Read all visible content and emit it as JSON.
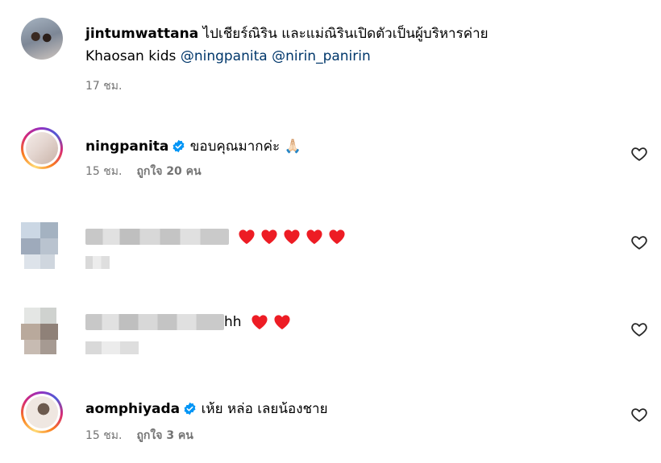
{
  "caption": {
    "username": "jintumwattana",
    "text_line1": " ไปเชียร์ณิริน และแม่ณิรินเปิดตัวเป็นผู้บริหารค่าย",
    "text_line2": "Khaosan kids ",
    "mention1": "@ningpanita",
    "mention2": "@nirin_panirin",
    "time": "17 ชม."
  },
  "comments": [
    {
      "username": "ningpanita",
      "verified": true,
      "text": " ขอบคุณมากค่ะ ",
      "emoji": "🙏🏻",
      "time": "15 ชม.",
      "likes": "ถูกใจ 20 คน"
    },
    {
      "username_blurred": true,
      "hearts": [
        "❤️",
        "❤️",
        "❤️",
        "❤️",
        "❤️"
      ]
    },
    {
      "username_blurred": true,
      "visible_text": "hh",
      "hearts": [
        "❤️",
        "❤️"
      ]
    },
    {
      "username": "aomphiyada",
      "verified": true,
      "text": " เห้ย หล่อ เลยน้องชาย",
      "time": "15 ชม.",
      "likes": "ถูกใจ 3 คน"
    }
  ],
  "icons": {
    "like": "heart-outline-icon",
    "verified": "verified-badge-icon"
  },
  "colors": {
    "mention": "#00376b",
    "meta": "#737373",
    "verified": "#0095f6",
    "heart": "#ed1c24"
  }
}
